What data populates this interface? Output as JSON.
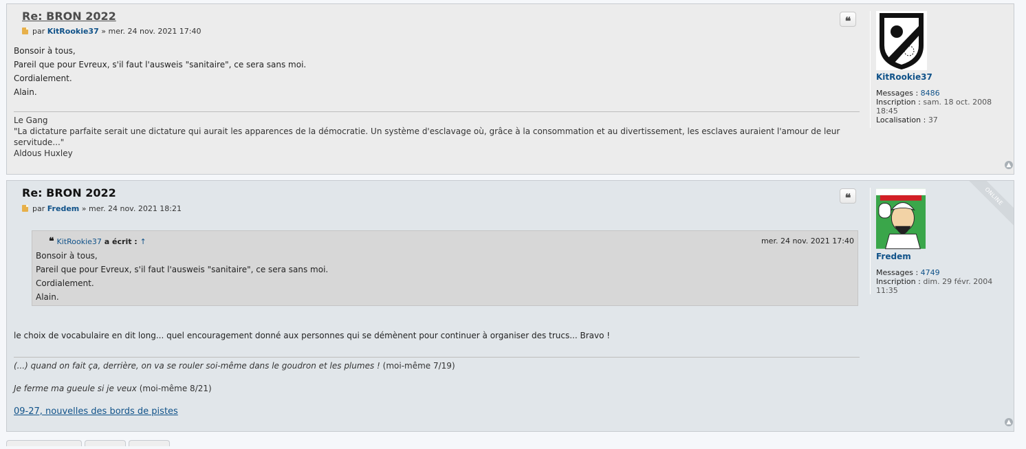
{
  "posts": [
    {
      "title": "Re: BRON 2022",
      "meta_by": "par",
      "author": "KitRookie37",
      "meta_sep": "»",
      "date": "mer. 24 nov. 2021 17:40",
      "content": [
        "Bonsoir à tous,",
        "Pareil que pour Evreux, s'il faut l'ausweis \"sanitaire\", ce sera sans moi.",
        "Cordialement.",
        "Alain."
      ],
      "signature": [
        "Le Gang",
        "\"La dictature parfaite serait une dictature qui aurait les apparences de la démocratie. Un système d'esclavage où, grâce à la consommation et au divertissement, les esclaves auraient l'amour de leur servitude...\"",
        "Aldous Huxley"
      ],
      "profile": {
        "name": "KitRookie37",
        "messages_label": "Messages :",
        "messages": "8486",
        "inscription_label": "Inscription :",
        "inscription": "sam. 18 oct. 2008 18:45",
        "localisation_label": "Localisation :",
        "localisation": "37"
      }
    },
    {
      "title": "Re: BRON 2022",
      "meta_by": "par",
      "author": "Fredem",
      "meta_sep": "»",
      "date": "mer. 24 nov. 2021 18:21",
      "online": "ONLINE",
      "quote": {
        "author": "KitRookie37",
        "wrote": "a écrit :",
        "arrow": "↑",
        "date": "mer. 24 nov. 2021 17:40",
        "lines": [
          "Bonsoir à tous,",
          "Pareil que pour Evreux, s'il faut l'ausweis \"sanitaire\", ce sera sans moi.",
          "Cordialement.",
          "Alain."
        ]
      },
      "reply": "le choix de vocabulaire en dit long... quel encouragement donné aux personnes qui se démènent pour continuer à organiser des trucs... Bravo !",
      "signature": {
        "line1_italic": "(...) quand on fait ça, derrière, on va se rouler soi-même dans le goudron et les plumes !",
        "line1_rest": "(moi-même 7/19)",
        "line2_italic": "Je ferme ma gueule si je veux",
        "line2_rest": "(moi-même 8/21)",
        "link": "09-27, nouvelles des bords de pistes"
      },
      "profile": {
        "name": "Fredem",
        "messages_label": "Messages :",
        "messages": "4749",
        "inscription_label": "Inscription :",
        "inscription": "dim. 29 févr. 2004 11:35"
      }
    }
  ],
  "icons": {
    "quote": "quote-icon",
    "top": "back-to-top-icon",
    "file": "post-file-icon"
  },
  "colors": {
    "link": "#105289",
    "post1_bg": "#ececec",
    "post2_bg": "#e1e6ea"
  }
}
